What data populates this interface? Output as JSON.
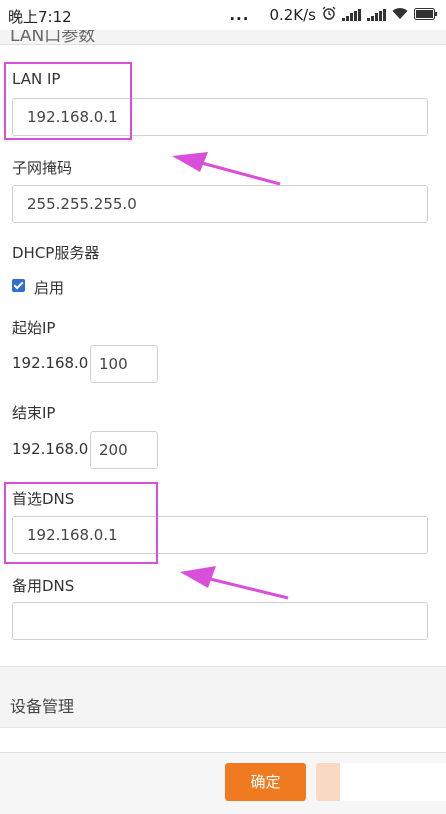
{
  "status_bar": {
    "time": "晚上7:12",
    "dots": "...",
    "speed": "0.2K/s"
  },
  "section_lan": {
    "title": "LAN口参数"
  },
  "lan_ip": {
    "label": "LAN IP",
    "value": "192.168.0.1"
  },
  "subnet_mask": {
    "label": "子网掩码",
    "value": "255.255.255.0"
  },
  "dhcp": {
    "label": "DHCP服务器",
    "enable_label": "启用",
    "enabled": true
  },
  "start_ip": {
    "label": "起始IP",
    "prefix": "192.168.0.",
    "value": "100"
  },
  "end_ip": {
    "label": "结束IP",
    "prefix": "192.168.0.",
    "value": "200"
  },
  "primary_dns": {
    "label": "首选DNS",
    "value": "192.168.0.1"
  },
  "secondary_dns": {
    "label": "备用DNS",
    "value": ""
  },
  "section_device": {
    "title": "设备管理"
  },
  "footer": {
    "confirm_label": "确定"
  },
  "colors": {
    "accent_orange": "#f07a1f",
    "highlight_magenta": "#d94fd9",
    "checkbox_blue": "#2f6fd1"
  }
}
